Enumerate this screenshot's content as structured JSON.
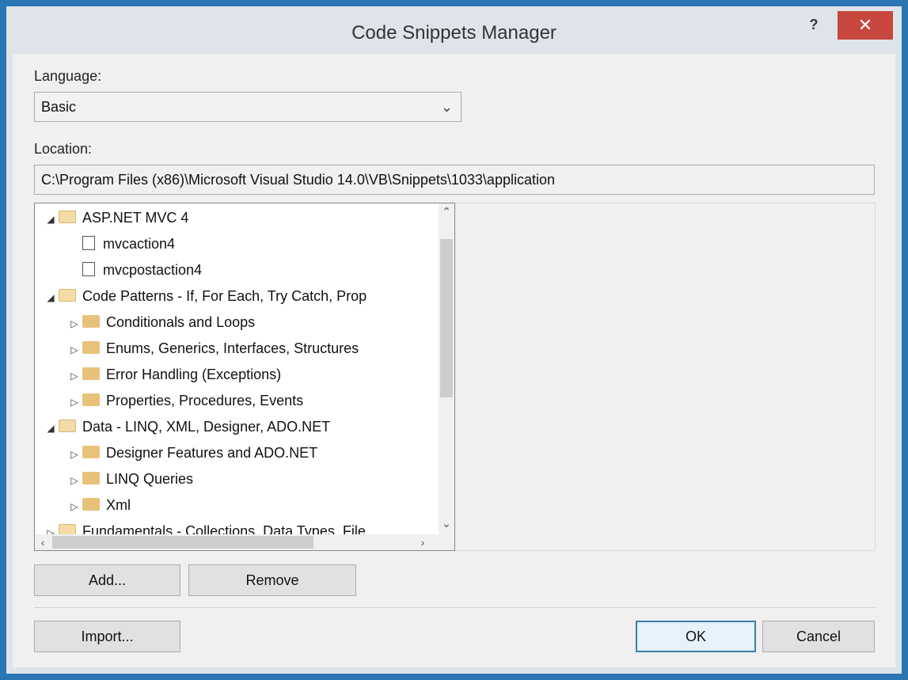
{
  "window": {
    "title": "Code Snippets Manager",
    "help_label": "?",
    "close_label": "✕"
  },
  "language": {
    "label": "Language:",
    "selected": "Basic"
  },
  "location": {
    "label": "Location:",
    "path": "C:\\Program Files (x86)\\Microsoft Visual Studio 14.0\\VB\\Snippets\\1033\\application"
  },
  "tree": {
    "items": [
      {
        "label": "ASP.NET MVC 4",
        "kind": "folder-open",
        "expander": "◢",
        "level": 0
      },
      {
        "label": "mvcaction4",
        "kind": "snippet",
        "expander": "",
        "level": 1
      },
      {
        "label": "mvcpostaction4",
        "kind": "snippet",
        "expander": "",
        "level": 1
      },
      {
        "label": "Code Patterns - If, For Each, Try Catch, Prop",
        "kind": "folder-open",
        "expander": "◢",
        "level": 0
      },
      {
        "label": "Conditionals and Loops",
        "kind": "folder",
        "expander": "▷",
        "level": 1
      },
      {
        "label": "Enums, Generics, Interfaces, Structures",
        "kind": "folder",
        "expander": "▷",
        "level": 1
      },
      {
        "label": "Error Handling (Exceptions)",
        "kind": "folder",
        "expander": "▷",
        "level": 1
      },
      {
        "label": "Properties, Procedures, Events",
        "kind": "folder",
        "expander": "▷",
        "level": 1
      },
      {
        "label": "Data - LINQ, XML, Designer, ADO.NET",
        "kind": "folder-open",
        "expander": "◢",
        "level": 0
      },
      {
        "label": "Designer Features and ADO.NET",
        "kind": "folder",
        "expander": "▷",
        "level": 1
      },
      {
        "label": "LINQ Queries",
        "kind": "folder",
        "expander": "▷",
        "level": 1
      },
      {
        "label": "Xml",
        "kind": "folder",
        "expander": "▷",
        "level": 1
      },
      {
        "label": "Fundamentals - Collections, Data Types, File",
        "kind": "folder-open",
        "expander": "▷",
        "level": 0
      }
    ]
  },
  "buttons": {
    "add": "Add...",
    "remove": "Remove",
    "import": "Import...",
    "ok": "OK",
    "cancel": "Cancel"
  },
  "colors": {
    "frame": "#2a75b3",
    "close": "#c7463d",
    "folder": "#e8c27a",
    "default_button_border": "#3c7fb1"
  }
}
